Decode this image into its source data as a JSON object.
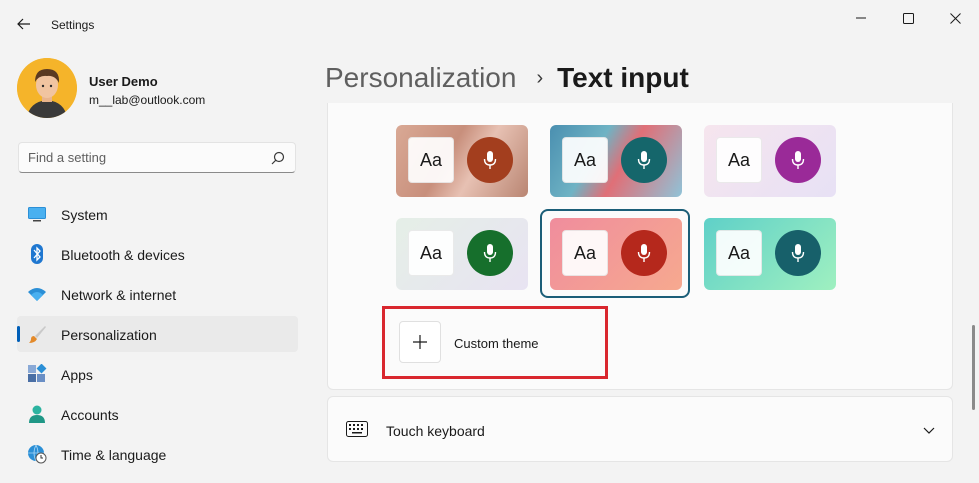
{
  "window": {
    "title": "Settings",
    "controls": {
      "minimize": "minimize-icon",
      "maximize": "maximize-icon",
      "close": "close-icon"
    }
  },
  "user": {
    "name": "User Demo",
    "email": "m__lab@outlook.com"
  },
  "search": {
    "placeholder": "Find a setting"
  },
  "nav": {
    "items": [
      {
        "label": "System",
        "icon": "monitor-icon"
      },
      {
        "label": "Bluetooth & devices",
        "icon": "bluetooth-icon"
      },
      {
        "label": "Network & internet",
        "icon": "wifi-icon"
      },
      {
        "label": "Personalization",
        "icon": "paintbrush-icon",
        "active": true
      },
      {
        "label": "Apps",
        "icon": "apps-icon"
      },
      {
        "label": "Accounts",
        "icon": "person-icon"
      },
      {
        "label": "Time & language",
        "icon": "globe-clock-icon"
      }
    ]
  },
  "header": {
    "parent": "Personalization",
    "separator": "›",
    "current": "Text input"
  },
  "themes": {
    "sample_text": "Aa",
    "selected_index": 4,
    "items": [
      {
        "name": "theme-1",
        "mic_color": "#a33e1e",
        "bg": "linear-gradient(120deg,#d9a995,#c88f7c 40%,#e7c1b3 60%,#b98572)"
      },
      {
        "name": "theme-2",
        "mic_color": "#15666b",
        "bg": "linear-gradient(120deg,#4a8fb0,#6fb3c4 35%,#e06f77 55%,#8fc3d8)"
      },
      {
        "name": "theme-3",
        "mic_color": "#9a2a98",
        "bg": "linear-gradient(135deg,#f6e5ee,#e7e1f5)"
      },
      {
        "name": "theme-4",
        "mic_color": "#166f2c",
        "bg": "linear-gradient(135deg,#e5efe7,#e8e3f2)"
      },
      {
        "name": "theme-5",
        "mic_color": "#b5281c",
        "bg": "linear-gradient(135deg,#f08d9d,#f6a98f)"
      },
      {
        "name": "theme-6",
        "mic_color": "#17606a",
        "bg": "linear-gradient(135deg,#5fd0c8,#9ff0c0)"
      }
    ]
  },
  "custom_theme": {
    "label": "Custom theme",
    "highlight_color": "#d9272e"
  },
  "touch_keyboard": {
    "label": "Touch keyboard"
  }
}
